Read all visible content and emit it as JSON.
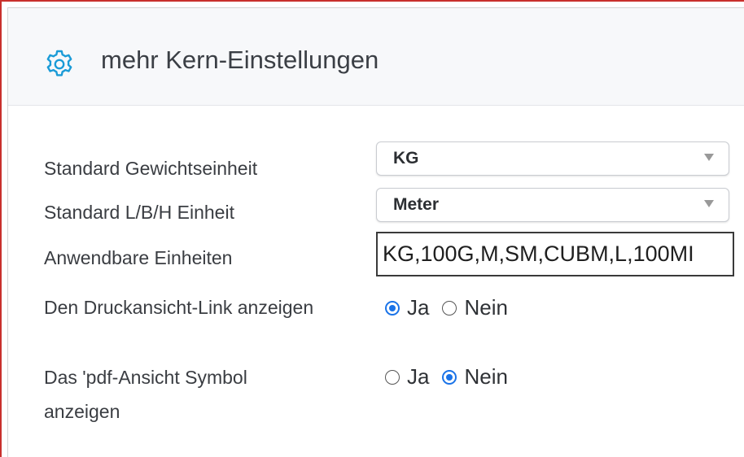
{
  "header": {
    "title": "mehr Kern-Einstellungen",
    "icon": "gear-icon",
    "accent": "#1a9bd7"
  },
  "fields": {
    "weight_unit": {
      "label": "Standard Gewichtseinheit",
      "value": "KG"
    },
    "dimension_unit": {
      "label": "Standard L/B/H Einheit",
      "value": "Meter"
    },
    "applicable_units": {
      "label": "Anwendbare Einheiten",
      "value": "KG,100G,M,SM,CUBM,L,100MI"
    },
    "print_link": {
      "label": "Den Druckansicht-Link anzeigen",
      "yes": "Ja",
      "no": "Nein",
      "selected": "Ja"
    },
    "pdf_symbol": {
      "label_line1": "Das 'pdf-Ansicht Symbol",
      "label_line2": "anzeigen",
      "yes": "Ja",
      "no": "Nein",
      "selected": "Nein"
    }
  },
  "colors": {
    "radio_checked": "#1a73e8",
    "frame": "#c9302c"
  }
}
